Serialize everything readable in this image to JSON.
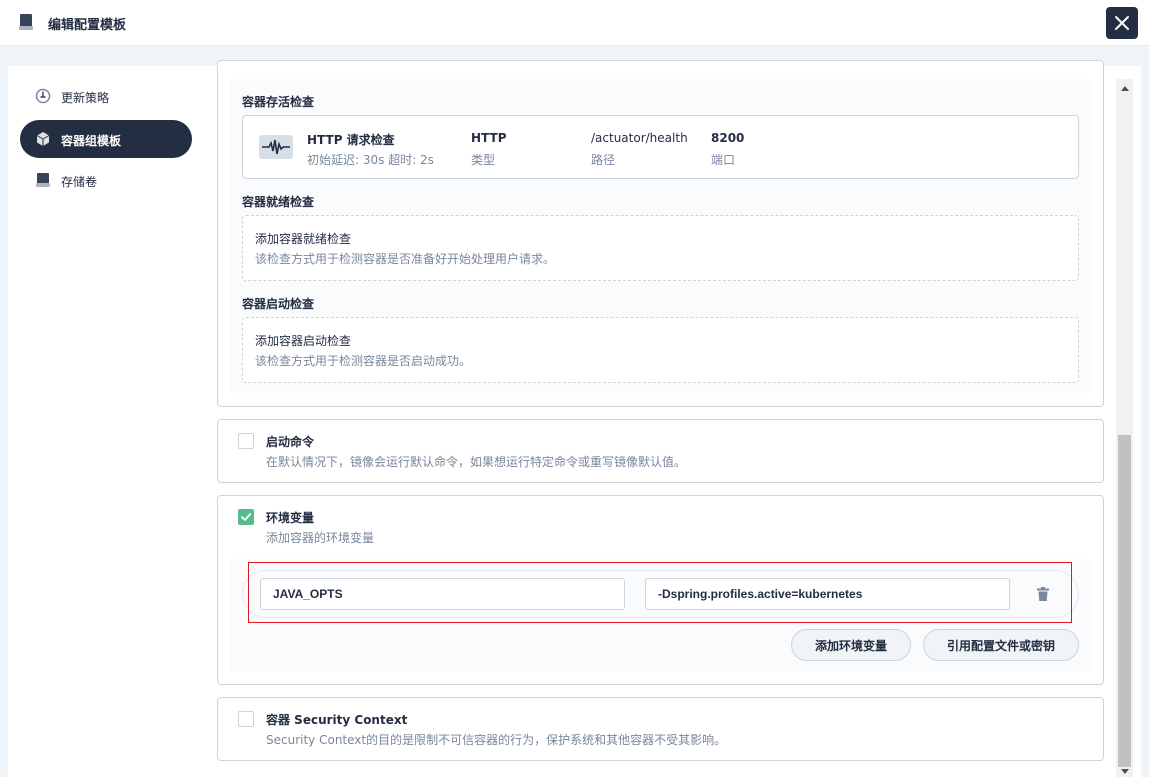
{
  "header": {
    "title": "编辑配置模板"
  },
  "sidebar": {
    "items": [
      {
        "label": "更新策略",
        "icon": "update-strategy-icon",
        "active": false
      },
      {
        "label": "容器组模板",
        "icon": "pod-template-icon",
        "active": true
      },
      {
        "label": "存储卷",
        "icon": "storage-volume-icon",
        "active": false
      }
    ]
  },
  "liveness": {
    "title": "容器存活检查",
    "probe": {
      "name": "HTTP 请求检查",
      "meta": "初始延迟: 30s  超时: 2s",
      "type_value": "HTTP",
      "type_label": "类型",
      "path_value": "/actuator/health",
      "path_label": "路径",
      "port_value": "8200",
      "port_label": "端口"
    }
  },
  "readiness": {
    "title": "容器就绪检查",
    "add_title": "添加容器就绪检查",
    "add_desc": "该检查方式用于检测容器是否准备好开始处理用户请求。"
  },
  "startup": {
    "title": "容器启动检查",
    "add_title": "添加容器启动检查",
    "add_desc": "该检查方式用于检测容器是否启动成功。"
  },
  "start_command": {
    "title": "启动命令",
    "desc": "在默认情况下，镜像会运行默认命令，如果想运行特定命令或重写镜像默认值。",
    "checked": false
  },
  "env": {
    "title": "环境变量",
    "desc": "添加容器的环境变量",
    "checked": true,
    "rows": [
      {
        "key": "JAVA_OPTS",
        "value": "-Dspring.profiles.active=kubernetes"
      }
    ],
    "add_button": "添加环境变量",
    "ref_button": "引用配置文件或密钥"
  },
  "security_context": {
    "title": "容器 Security Context",
    "desc": "Security Context的目的是限制不可信容器的行为，保护系统和其他容器不受其影响。",
    "checked": false
  },
  "colors": {
    "primary_dark": "#242e42",
    "green": "#55bc8a",
    "highlight_red": "#e0181f",
    "muted_text": "#79879c",
    "border": "#ccd3db"
  }
}
